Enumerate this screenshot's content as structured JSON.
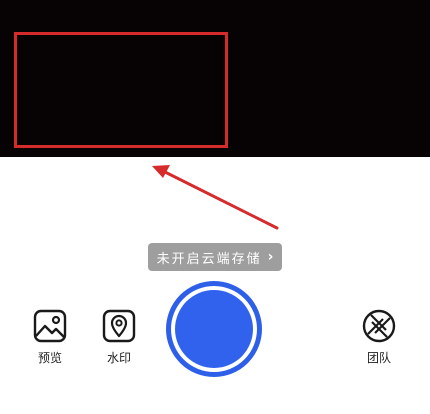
{
  "camera": {
    "cloud_storage_notice": "未开启云端存储",
    "cloud_storage_chevron": "›"
  },
  "toolbar": {
    "preview_label": "预览",
    "watermark_label": "水印",
    "team_label": "团队"
  },
  "icons": {
    "preview": "image-icon",
    "watermark": "map-pin-icon",
    "team": "aperture-icon",
    "shutter": "shutter-button"
  },
  "colors": {
    "viewfinder_bg": "#070204",
    "annotation_red": "#d62b2b",
    "shutter_blue": "#3162ee",
    "pill_gray": "#9e9e9e"
  }
}
